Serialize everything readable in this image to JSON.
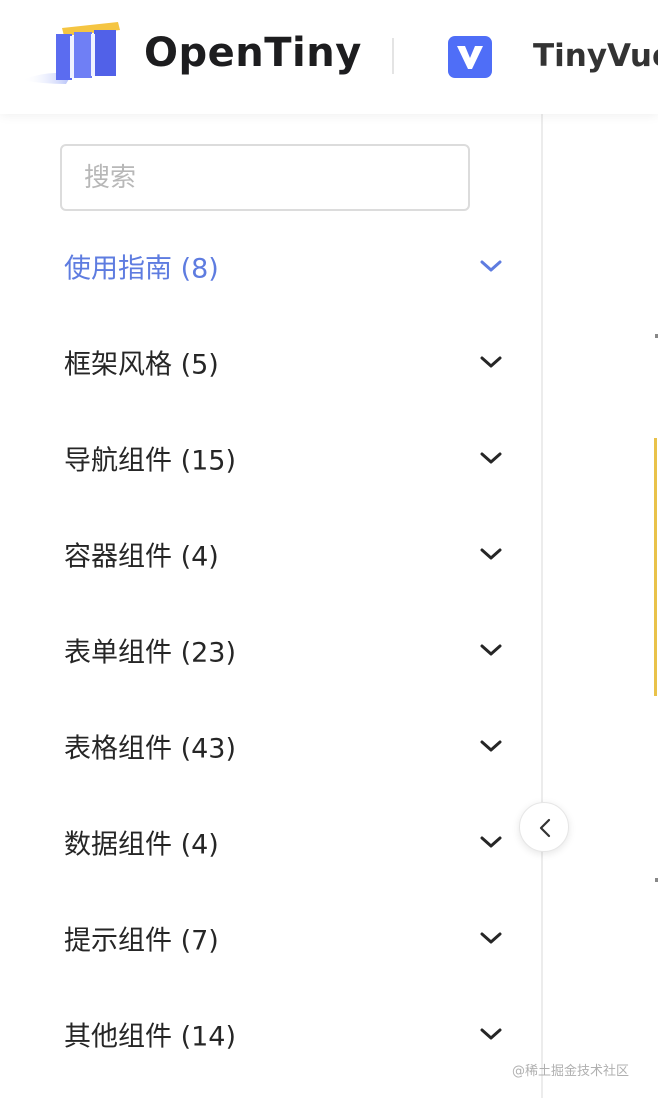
{
  "header": {
    "brand": "OpenTiny",
    "product": "TinyVue",
    "colors": {
      "logo_blue": "#5b6cf0",
      "logo_yellow": "#f5c542",
      "tinyvue_icon": "#4f6ef7"
    }
  },
  "search": {
    "placeholder": "搜索",
    "value": ""
  },
  "menu": {
    "items": [
      {
        "label": "使用指南 (8)",
        "active": true
      },
      {
        "label": "框架风格 (5)",
        "active": false
      },
      {
        "label": "导航组件 (15)",
        "active": false
      },
      {
        "label": "容器组件 (4)",
        "active": false
      },
      {
        "label": "表单组件 (23)",
        "active": false
      },
      {
        "label": "表格组件 (43)",
        "active": false
      },
      {
        "label": "数据组件 (4)",
        "active": false
      },
      {
        "label": "提示组件 (7)",
        "active": false
      },
      {
        "label": "其他组件 (14)",
        "active": false
      }
    ],
    "colors": {
      "active": "#5e7ce0",
      "default": "#262626"
    }
  },
  "watermark": "@稀土掘金技术社区"
}
